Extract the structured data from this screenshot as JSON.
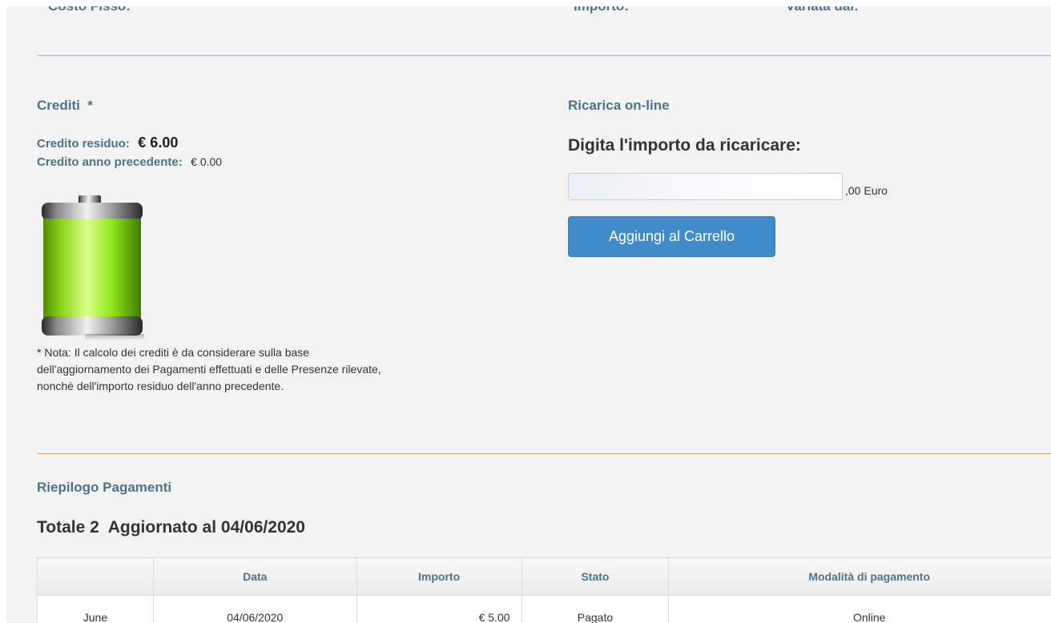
{
  "top_labels": {
    "costo_fisso": "Costo Fisso:",
    "importo": "Importo:",
    "variata_dal": "Variata dal:"
  },
  "crediti": {
    "title": "Crediti",
    "asterisk": "*",
    "residuo_label": "Credito residuo:",
    "residuo_value": "€ 6.00",
    "anno_prec_label": "Credito anno precedente:",
    "anno_prec_value": "€ 0.00",
    "battery_icon": "battery-full-icon",
    "note_line1": "* Nota: Il calcolo dei crediti è da considerare sulla base",
    "note_line2": "dell'aggiornamento dei Pagamenti effettuati e delle Presenze rilevate,",
    "note_line3": "nonchè dell'importo residuo dell'anno precedente."
  },
  "ricarica": {
    "title": "Ricarica on-line",
    "prompt": "Digita l'importo da ricaricare:",
    "input_value": "",
    "suffix": ",00 Euro",
    "button_label": "Aggiungi al Carrello"
  },
  "riepilogo": {
    "title": "Riepilogo Pagamenti",
    "totale_label": "Totale",
    "totale_count": "2",
    "aggiornato": "Aggiornato al 04/06/2020",
    "columns": [
      "",
      "Data",
      "Importo",
      "Stato",
      "Modalità di pagamento"
    ],
    "rows": [
      [
        "June",
        "04/06/2020",
        "€ 5.00",
        "Pagato",
        "Online"
      ]
    ]
  },
  "colors": {
    "accent_blue": "#4c7486",
    "button_blue": "#428bca",
    "divider_orange": "#e8a56b",
    "battery_green": "#8fe81a"
  }
}
